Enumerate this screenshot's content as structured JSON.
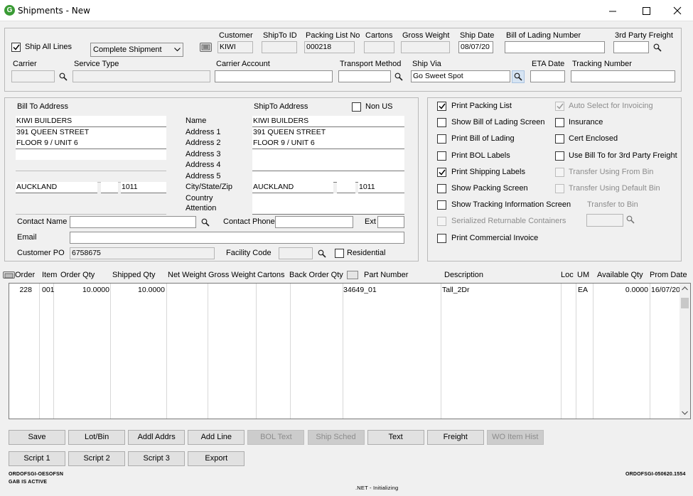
{
  "window": {
    "title": "Shipments - New",
    "icon": "G"
  },
  "header": {
    "ship_all_lines": {
      "label": "Ship All Lines",
      "checked": true
    },
    "shipment_type": "Complete Shipment",
    "customer": {
      "label": "Customer",
      "value": "KIWI"
    },
    "shipto_id": {
      "label": "ShipTo ID",
      "value": ""
    },
    "packing_list_no": {
      "label": "Packing List No",
      "value": "000218"
    },
    "cartons": {
      "label": "Cartons",
      "value": ""
    },
    "gross_weight": {
      "label": "Gross Weight",
      "value": ""
    },
    "ship_date": {
      "label": "Ship Date",
      "value": "08/07/20"
    },
    "bol_number": {
      "label": "Bill of Lading Number",
      "value": ""
    },
    "third_party_freight": {
      "label": "3rd Party Freight",
      "value": ""
    },
    "carrier": {
      "label": "Carrier",
      "value": ""
    },
    "service_type": {
      "label": "Service Type",
      "value": ""
    },
    "carrier_account": {
      "label": "Carrier Account",
      "value": ""
    },
    "transport_method": {
      "label": "Transport Method",
      "value": ""
    },
    "ship_via": {
      "label": "Ship Via",
      "value": "Go Sweet Spot"
    },
    "eta_date": {
      "label": "ETA Date",
      "value": ""
    },
    "tracking_number": {
      "label": "Tracking Number",
      "value": ""
    }
  },
  "address": {
    "bill_to_label": "Bill To Address",
    "ship_to_label": "ShipTo Address",
    "non_us": {
      "label": "Non US",
      "checked": false
    },
    "row_labels": [
      "Name",
      "Address 1",
      "Address 2",
      "Address 3",
      "Address 4",
      "Address 5",
      "City/State/Zip",
      "Country",
      "Attention"
    ],
    "bill_to": {
      "name": "KIWI BUILDERS",
      "address1": "391 QUEEN STREET",
      "address2": "FLOOR 9 / UNIT 6",
      "address3": "",
      "address4": "",
      "address5": "",
      "city": "AUCKLAND",
      "state": "",
      "zip": "1011",
      "country": "",
      "attention": ""
    },
    "ship_to": {
      "name": "KIWI BUILDERS",
      "address1": "391 QUEEN STREET",
      "address2": "FLOOR 9 / UNIT 6",
      "address3": "",
      "address4": "",
      "address5": "",
      "city": "AUCKLAND",
      "state": "",
      "zip": "1011",
      "country": "",
      "attention": ""
    },
    "contact_name": {
      "label": "Contact Name",
      "value": ""
    },
    "contact_phone": {
      "label": "Contact Phone",
      "value": ""
    },
    "ext": {
      "label": "Ext",
      "value": ""
    },
    "email": {
      "label": "Email",
      "value": ""
    },
    "customer_po": {
      "label": "Customer PO",
      "value": "6758675"
    },
    "facility_code": {
      "label": "Facility Code",
      "value": ""
    },
    "residential": {
      "label": "Residential",
      "checked": false
    }
  },
  "options": {
    "left": [
      {
        "label": "Print Packing List",
        "checked": true,
        "enabled": true
      },
      {
        "label": "Show Bill of Lading Screen",
        "checked": false,
        "enabled": true
      },
      {
        "label": "Print Bill of Lading",
        "checked": false,
        "enabled": true
      },
      {
        "label": "Print BOL Labels",
        "checked": false,
        "enabled": true
      },
      {
        "label": "Print Shipping Labels",
        "checked": true,
        "enabled": true
      },
      {
        "label": "Show Packing Screen",
        "checked": false,
        "enabled": true
      },
      {
        "label": "Show Tracking Information Screen",
        "checked": false,
        "enabled": true
      },
      {
        "label": "Serialized Returnable Containers",
        "checked": false,
        "enabled": false
      },
      {
        "label": "Print Commercial Invoice",
        "checked": false,
        "enabled": true
      }
    ],
    "right": [
      {
        "label": "Auto Select for Invoicing",
        "checked": true,
        "enabled": false
      },
      {
        "label": "Insurance",
        "checked": false,
        "enabled": true
      },
      {
        "label": "Cert Enclosed",
        "checked": false,
        "enabled": true
      },
      {
        "label": "Use Bill To for 3rd Party Freight",
        "checked": false,
        "enabled": true
      },
      {
        "label": "Transfer Using From Bin",
        "checked": false,
        "enabled": false
      },
      {
        "label": "Transfer Using Default Bin",
        "checked": false,
        "enabled": false
      }
    ],
    "transfer_to_bin": {
      "label": "Transfer to Bin",
      "value": ""
    }
  },
  "lines": {
    "columns": [
      "Order",
      "Item",
      "Order Qty",
      "Shipped Qty",
      "Net Weight",
      "Gross Weight",
      "Cartons",
      "Back Order Qty",
      "Part Number",
      "Description",
      "Loc",
      "UM",
      "Available Qty",
      "Prom Date"
    ],
    "rows": [
      {
        "order": "228",
        "item": "001",
        "order_qty": "10.0000",
        "shipped_qty": "10.0000",
        "net_weight": "",
        "gross_weight": "",
        "cartons": "",
        "back_order_qty": "",
        "part_number": "34649_01",
        "description": "Tall_2Dr",
        "loc": "",
        "um": "EA",
        "available_qty": "0.0000",
        "prom_date": "16/07/20"
      }
    ]
  },
  "buttons": {
    "row1": [
      {
        "label": "Save",
        "enabled": true
      },
      {
        "label": "Lot/Bin",
        "enabled": true
      },
      {
        "label": "Addl Addrs",
        "enabled": true
      },
      {
        "label": "Add Line",
        "enabled": true
      },
      {
        "label": "BOL Text",
        "enabled": false
      },
      {
        "label": "Ship Sched",
        "enabled": false
      },
      {
        "label": "Text",
        "enabled": true
      },
      {
        "label": "Freight",
        "enabled": true
      },
      {
        "label": "WO Item Hist",
        "enabled": false
      }
    ],
    "row2": [
      {
        "label": "Script 1",
        "enabled": true
      },
      {
        "label": "Script 2",
        "enabled": true
      },
      {
        "label": "Script 3",
        "enabled": true
      },
      {
        "label": "Export",
        "enabled": true
      }
    ]
  },
  "status": {
    "program": "ORDOFSGI-OESOFSN",
    "gab": "GAB IS ACTIVE",
    "net": ".NET - Initializing",
    "version": "ORDOFSGI-050620.1554"
  }
}
